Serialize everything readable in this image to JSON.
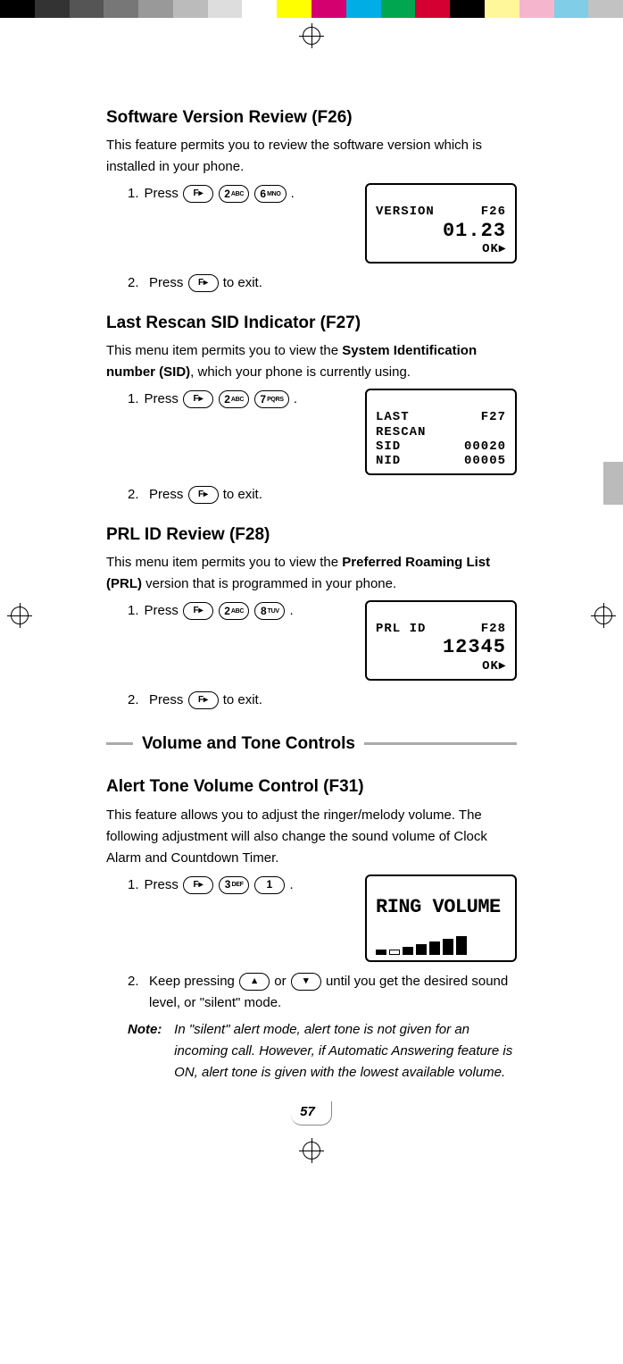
{
  "color_strip": [
    "#000",
    "#333",
    "#555",
    "#777",
    "#999",
    "#bbb",
    "#ddd",
    "#fff",
    "#ff0",
    "#d4006f",
    "#00aee6",
    "#00a650",
    "#d50032",
    "#000",
    "#fff799",
    "#f5b6cd",
    "#7fcde6",
    "#c2c2c2"
  ],
  "sections": {
    "f26": {
      "heading": "Software Version Review (F26)",
      "desc": "This feature permits you to review the software version which is installed in your phone.",
      "step1_pre": "Press",
      "step1_post": ".",
      "key2": {
        "main": "2",
        "sub": "ABC"
      },
      "key6": {
        "main": "6",
        "sub": "MNO"
      },
      "lcd_line1a": "VERSION",
      "lcd_line1b": "F26",
      "lcd_big": "01.23",
      "lcd_ok": "OK▸",
      "step2_pre": "Press",
      "step2_post": "to exit."
    },
    "f27": {
      "heading": "Last Rescan SID Indicator (F27)",
      "desc_a": "This menu item permits you to view the ",
      "desc_bold": "System Identification number (SID)",
      "desc_b": ", which your phone is currently using.",
      "step1_pre": "Press",
      "step1_post": ".",
      "key2": {
        "main": "2",
        "sub": "ABC"
      },
      "key7": {
        "main": "7",
        "sub": "PQRS"
      },
      "lcd_l1a": "LAST",
      "lcd_l1b": "F27",
      "lcd_l2": "RESCAN",
      "lcd_l3a": "SID",
      "lcd_l3b": "00020",
      "lcd_l4a": "NID",
      "lcd_l4b": "00005",
      "step2_pre": "Press",
      "step2_post": "to exit."
    },
    "f28": {
      "heading": "PRL ID Review (F28)",
      "desc_a": "This menu item permits you to view the ",
      "desc_bold": "Preferred Roaming List (PRL)",
      "desc_b": " version that is programmed in your phone.",
      "step1_pre": "Press",
      "step1_post": ".",
      "key2": {
        "main": "2",
        "sub": "ABC"
      },
      "key8": {
        "main": "8",
        "sub": "TUV"
      },
      "lcd_l1a": "PRL ID",
      "lcd_l1b": "F28",
      "lcd_big": "12345",
      "lcd_ok": "OK▸",
      "step2_pre": "Press",
      "step2_post": "to exit."
    },
    "banner": "Volume and Tone Controls",
    "f31": {
      "heading": "Alert Tone Volume Control (F31)",
      "desc": "This feature allows you to adjust the ringer/melody volume. The following adjustment will also change the sound volume of Clock Alarm and Countdown Timer.",
      "step1_pre": "Press",
      "step1_post": ".",
      "key3": {
        "main": "3",
        "sub": "DEF"
      },
      "key1": {
        "main": "1",
        "sub": ""
      },
      "lcd_title": "RING VOLUME",
      "step2_a": "Keep pressing",
      "step2_b": "or",
      "step2_c": "until you get the desired sound level, or \"silent\" mode.",
      "note_label": "Note:",
      "note_body": "In \"silent\" alert mode, alert tone is not given for an incoming call. However, if Automatic Answering feature is ON, alert tone is given with the lowest available volume."
    }
  },
  "page_number": "57"
}
